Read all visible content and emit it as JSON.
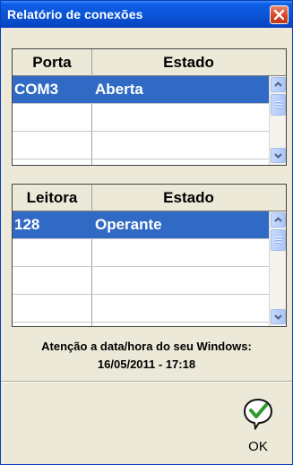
{
  "window": {
    "title": "Relatório de conexões"
  },
  "ports_grid": {
    "headers": [
      "Porta",
      "Estado"
    ],
    "rows": [
      {
        "col1": "COM3",
        "col2": "Aberta"
      }
    ]
  },
  "readers_grid": {
    "headers": [
      "Leitora",
      "Estado"
    ],
    "rows": [
      {
        "col1": "128",
        "col2": "Operante"
      }
    ]
  },
  "warning": {
    "line1": "Atenção a data/hora do seu Windows:",
    "line2": "16/05/2011 - 17:18"
  },
  "ok_button": {
    "label": "OK"
  },
  "colors": {
    "titlebar": "#0a55d8",
    "selection": "#316ac5",
    "dialog_bg": "#ece9d8"
  }
}
